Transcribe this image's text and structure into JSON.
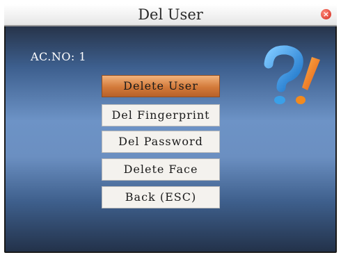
{
  "window": {
    "title": "Del User"
  },
  "screen": {
    "ac_label": "AC.NO:",
    "ac_value": "1"
  },
  "menu": {
    "items": [
      {
        "label": "Delete User",
        "selected": true
      },
      {
        "label": "Del Fingerprint",
        "selected": false
      },
      {
        "label": "Del  Password",
        "selected": false
      },
      {
        "label": "Delete Face",
        "selected": false
      },
      {
        "label": "Back (ESC)",
        "selected": false
      }
    ]
  },
  "icons": {
    "close": "close-icon",
    "help": "help-question-icon"
  },
  "colors": {
    "selected": "#d37a3a",
    "screen_mid": "#6d93c6",
    "question_blue": "#3aa0e8",
    "exclamation_orange": "#f28a1e"
  }
}
